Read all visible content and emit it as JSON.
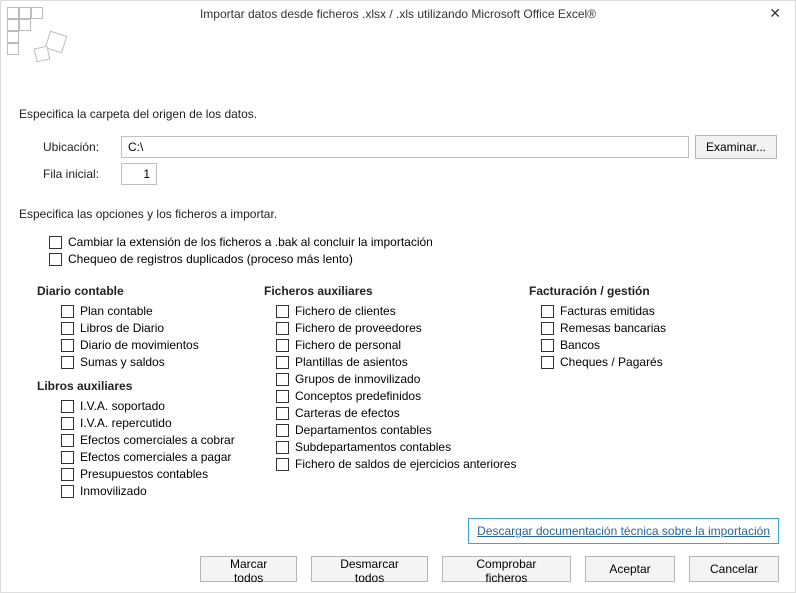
{
  "title": "Importar datos desde ficheros .xlsx / .xls utilizando Microsoft Office Excel®",
  "section1_text": "Especifica la carpeta del origen de los datos.",
  "location": {
    "label": "Ubicación:",
    "value": "C:\\",
    "browse": "Examinar..."
  },
  "row": {
    "label": "Fila inicial:",
    "value": "1"
  },
  "section2_text": "Especifica las opciones y los ficheros a importar.",
  "options": {
    "bak": "Cambiar la extensión de los ficheros a .bak al concluir la importación",
    "dup": "Chequeo de registros duplicados (proceso más lento)"
  },
  "groups": {
    "diario": {
      "title": "Diario contable",
      "items": [
        "Plan contable",
        "Libros de Diario",
        "Diario de movimientos",
        "Sumas y saldos"
      ]
    },
    "libros": {
      "title": "Libros auxiliares",
      "items": [
        "I.V.A. soportado",
        "I.V.A. repercutido",
        "Efectos comerciales a cobrar",
        "Efectos comerciales a pagar",
        "Presupuestos contables",
        "Inmovilizado"
      ]
    },
    "ficheros": {
      "title": "Ficheros auxiliares",
      "items": [
        "Fichero de clientes",
        "Fichero de proveedores",
        "Fichero de personal",
        "Plantillas de asientos",
        "Grupos de inmovilizado",
        "Conceptos predefinidos",
        "Carteras de efectos",
        "Departamentos contables",
        "Subdepartamentos contables",
        "Fichero de saldos de ejercicios anteriores"
      ]
    },
    "facturacion": {
      "title": "Facturación / gestión",
      "items": [
        "Facturas emitidas",
        "Remesas bancarias",
        "Bancos",
        "Cheques / Pagarés"
      ]
    }
  },
  "link_text": "Descargar documentación técnica sobre la importación",
  "buttons": {
    "mark_all": "Marcar todos",
    "unmark_all": "Desmarcar todos",
    "check_files": "Comprobar ficheros",
    "ok": "Aceptar",
    "cancel": "Cancelar"
  }
}
